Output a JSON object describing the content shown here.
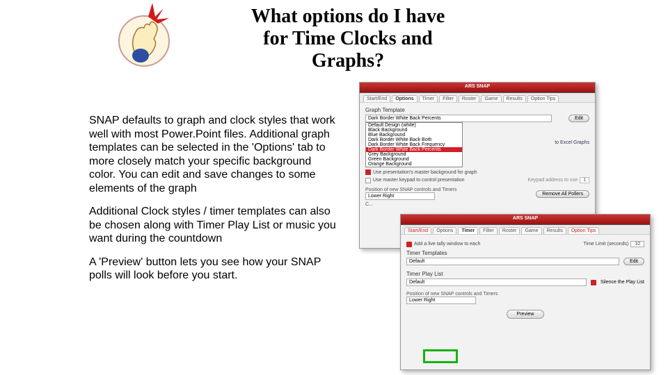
{
  "title": "What options do I have for Time Clocks and Graphs?",
  "paragraphs": {
    "p1": "SNAP defaults to graph and clock styles that work well with most Power.Point files. Additional graph templates can be selected in the 'Options' tab to more closely match your specific background color.  You can edit and save changes to some elements of the graph",
    "p2": "Additional Clock styles / timer templates can also be chosen along with Timer Play List or music you want during the countdown",
    "p3": "A 'Preview' button lets you see how your SNAP polls will look before you start."
  },
  "app_title": "ARS SNAP",
  "win1": {
    "tabs": [
      "Start/End",
      "Options",
      "Timer",
      "Filter",
      "Roster",
      "Game",
      "Results",
      "Option Tips"
    ],
    "active_tab": 1,
    "section_label": "Graph Template",
    "selected_template": "Dark Border White Back Percents",
    "template_list": [
      "Default Design (white)",
      "Black Background",
      "Blue Background",
      "Dark Border White Back Both",
      "Dark Border White Back Frequency",
      "Dark Border White Back Percents",
      "Grey Background",
      "Green Background",
      "Orange Background"
    ],
    "selected_index": 5,
    "edit_btn": "Edit",
    "export_link": "to Excel Graphs",
    "chk1": "Use presentation's master background for graph",
    "chk2": "Use master keypad to control presentation",
    "chk2_sub": "Keypad address to use",
    "chk2_val": "1",
    "pos_label": "Position of new SNAP controls and Timers",
    "pos_value": "Lower Right",
    "remove_btn": "Remove All Pollers",
    "trunc": "C..."
  },
  "win2": {
    "tabs": [
      "Start/End",
      "Options",
      "Timer",
      "Filter",
      "Roster",
      "Game",
      "Results",
      "Option Tips"
    ],
    "active_tab": 2,
    "tally_chk": "Add a live tally window to each",
    "timelimit_label": "Time Limit (seconds)",
    "timelimit_val": "10",
    "section_templates": "Timer Templates",
    "templates_value": "Default",
    "edit_btn": "Edit",
    "section_playlist": "Timer Play List",
    "playlist_value": "Default",
    "silence_chk": "Silence the Play List",
    "pos_label": "Position of new SNAP controls and Timers",
    "pos_value": "Lower Right",
    "preview_btn": "Preview"
  }
}
